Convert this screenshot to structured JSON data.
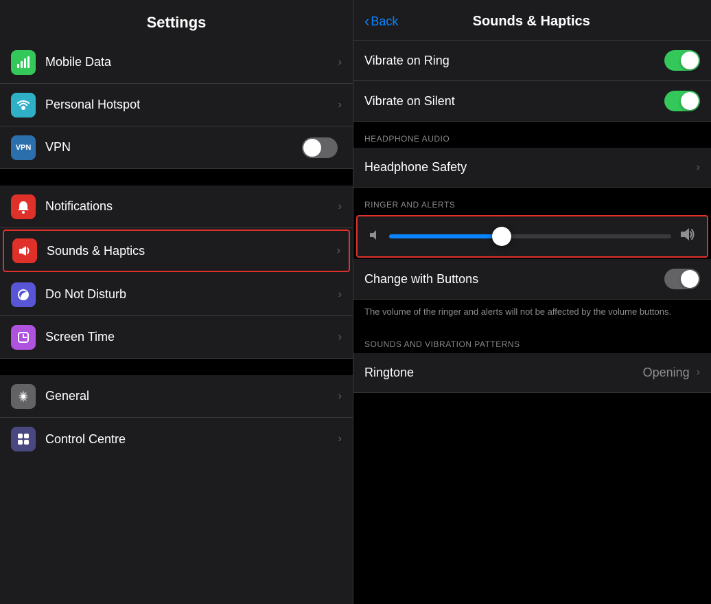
{
  "left": {
    "title": "Settings",
    "items": [
      {
        "id": "mobile-data",
        "label": "Mobile Data",
        "icon": "📶",
        "icon_class": "icon-green",
        "has_chevron": true,
        "has_toggle": false,
        "active": false
      },
      {
        "id": "personal-hotspot",
        "label": "Personal Hotspot",
        "icon": "🔗",
        "icon_class": "icon-teal",
        "has_chevron": true,
        "has_toggle": false,
        "active": false
      },
      {
        "id": "vpn",
        "label": "VPN",
        "icon": "VPN",
        "icon_class": "icon-blue-dark",
        "has_chevron": false,
        "has_toggle": true,
        "toggle_on": false,
        "active": false
      },
      {
        "id": "notifications",
        "label": "Notifications",
        "icon": "🔔",
        "icon_class": "icon-red",
        "has_chevron": true,
        "has_toggle": false,
        "active": false
      },
      {
        "id": "sounds-haptics",
        "label": "Sounds & Haptics",
        "icon": "🔊",
        "icon_class": "icon-red-sound",
        "has_chevron": true,
        "has_toggle": false,
        "active": true
      },
      {
        "id": "do-not-disturb",
        "label": "Do Not Disturb",
        "icon": "🌙",
        "icon_class": "icon-indigo",
        "has_chevron": true,
        "has_toggle": false,
        "active": false
      },
      {
        "id": "screen-time",
        "label": "Screen Time",
        "icon": "⏱",
        "icon_class": "icon-purple",
        "has_chevron": true,
        "has_toggle": false,
        "active": false
      },
      {
        "id": "general",
        "label": "General",
        "icon": "⚙",
        "icon_class": "icon-gray",
        "has_chevron": true,
        "has_toggle": false,
        "active": false
      },
      {
        "id": "control-centre",
        "label": "Control Centre",
        "icon": "⊞",
        "icon_class": "icon-dark-indigo",
        "has_chevron": true,
        "has_toggle": false,
        "active": false
      }
    ]
  },
  "right": {
    "back_label": "Back",
    "title": "Sounds & Haptics",
    "items": [
      {
        "id": "vibrate-on-ring",
        "label": "Vibrate on Ring",
        "toggle_on": true
      },
      {
        "id": "vibrate-on-silent",
        "label": "Vibrate on Silent",
        "toggle_on": true
      }
    ],
    "sections": {
      "headphone_audio": {
        "header": "HEADPHONE AUDIO",
        "items": [
          {
            "id": "headphone-safety",
            "label": "Headphone Safety",
            "has_chevron": true
          }
        ]
      },
      "ringer_alerts": {
        "header": "RINGER AND ALERTS",
        "slider_value": 40,
        "change_with_buttons": {
          "label": "Change with Buttons",
          "toggle_on": false
        },
        "description": "The volume of the ringer and alerts will not be affected by the volume buttons."
      },
      "sounds_vibration": {
        "header": "SOUNDS AND VIBRATION PATTERNS",
        "items": [
          {
            "id": "ringtone",
            "label": "Ringtone",
            "value": "Opening"
          }
        ]
      }
    }
  }
}
